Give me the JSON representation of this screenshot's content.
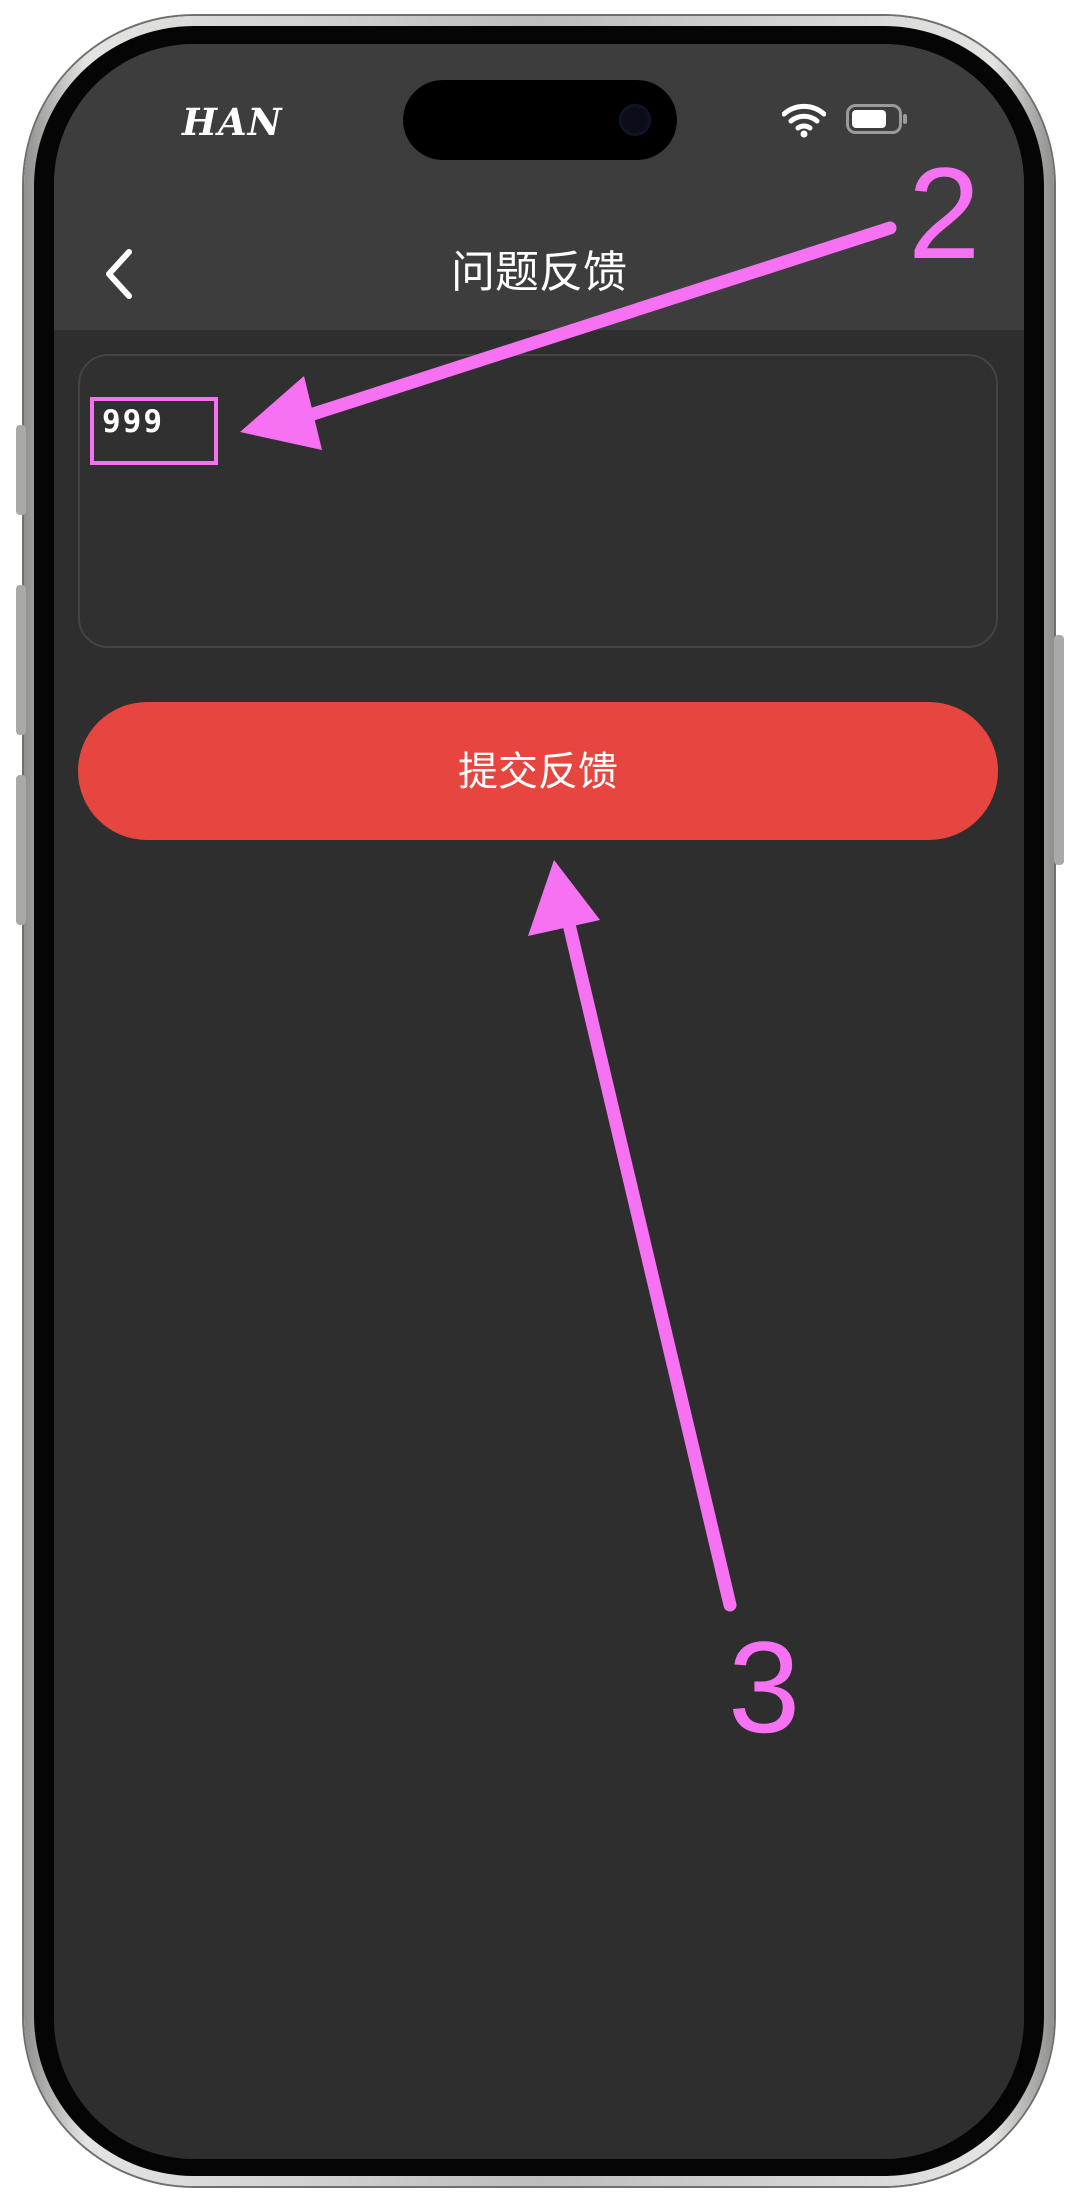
{
  "status_bar": {
    "carrier": "HAN",
    "wifi_icon": "wifi-icon",
    "battery_icon": "battery-icon"
  },
  "nav": {
    "back_icon": "chevron-left-icon",
    "title": "问题反馈"
  },
  "feedback": {
    "input_value": "999"
  },
  "submit": {
    "label": "提交反馈"
  },
  "annotations": {
    "labels": [
      "2",
      "3"
    ],
    "color": "#f772f3"
  },
  "colors": {
    "screen_bg": "#2f2e2f",
    "nav_bg": "#3e3d3e",
    "button": "#e6463f"
  }
}
